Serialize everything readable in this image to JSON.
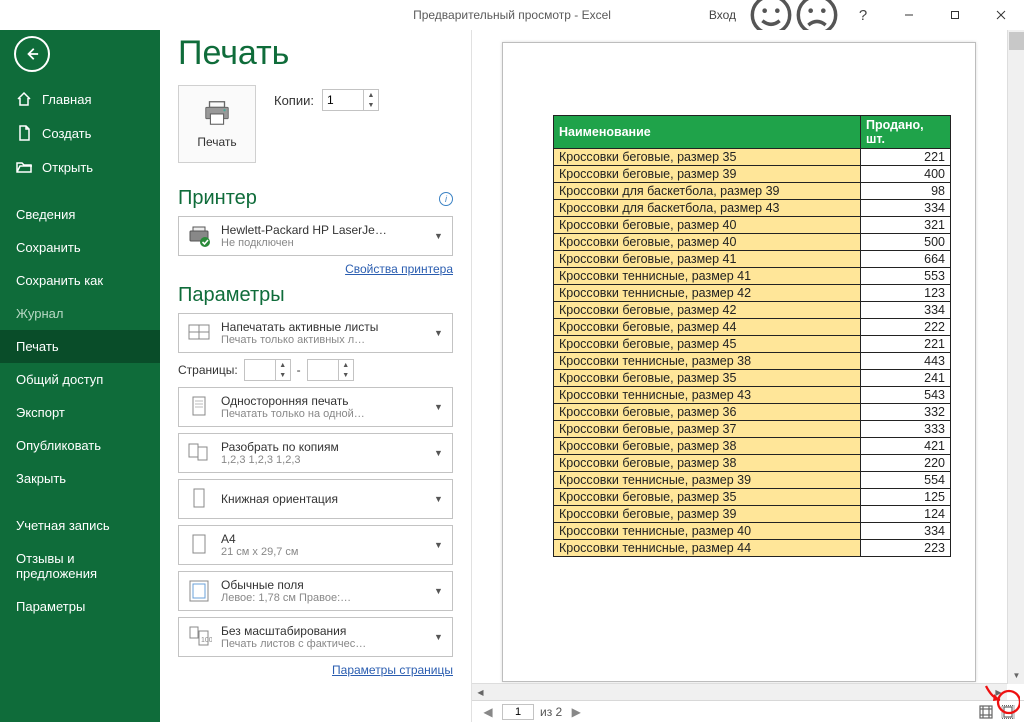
{
  "titlebar": {
    "title": "Предварительный просмотр  -  Excel",
    "login": "Вход"
  },
  "sidebar": {
    "items": [
      {
        "label": "Главная"
      },
      {
        "label": "Создать"
      },
      {
        "label": "Открыть"
      },
      {
        "label": "Сведения"
      },
      {
        "label": "Сохранить"
      },
      {
        "label": "Сохранить как"
      },
      {
        "label": "Журнал"
      },
      {
        "label": "Печать"
      },
      {
        "label": "Общий доступ"
      },
      {
        "label": "Экспорт"
      },
      {
        "label": "Опубликовать"
      },
      {
        "label": "Закрыть"
      },
      {
        "label": "Учетная запись"
      },
      {
        "label": "Отзывы и предложения"
      },
      {
        "label": "Параметры"
      }
    ]
  },
  "page_title": "Печать",
  "print": {
    "button": "Печать",
    "copies_label": "Копии:",
    "copies_value": "1"
  },
  "printer": {
    "section": "Принтер",
    "name": "Hewlett-Packard HP LaserJe…",
    "status": "Не подключен",
    "props_link": "Свойства принтера"
  },
  "params": {
    "section": "Параметры",
    "active_sheets": {
      "l1": "Напечатать активные листы",
      "l2": "Печать только активных л…"
    },
    "pages_label": "Страницы:",
    "pages_sep": "-",
    "duplex": {
      "l1": "Односторонняя печать",
      "l2": "Печатать только на одной…"
    },
    "collate": {
      "l1": "Разобрать по копиям",
      "l2": "1,2,3   1,2,3   1,2,3"
    },
    "orient": {
      "l1": "Книжная ориентация"
    },
    "paper": {
      "l1": "A4",
      "l2": "21 см x 29,7 см"
    },
    "margins": {
      "l1": "Обычные поля",
      "l2": "Левое:  1,78 см   Правое:…"
    },
    "scaling": {
      "l1": "Без масштабирования",
      "l2": "Печать листов с фактичес…"
    },
    "page_setup_link": "Параметры страницы"
  },
  "preview": {
    "current_page": "1",
    "total_label": "из 2",
    "table_header": [
      "Наименование",
      "Продано, шт."
    ],
    "rows": [
      [
        "Кроссовки беговые, размер 35",
        "221"
      ],
      [
        "Кроссовки беговые, размер 39",
        "400"
      ],
      [
        "Кроссовки для баскетбола, размер 39",
        "98"
      ],
      [
        "Кроссовки для баскетбола, размер 43",
        "334"
      ],
      [
        "Кроссовки беговые, размер 40",
        "321"
      ],
      [
        "Кроссовки беговые, размер 40",
        "500"
      ],
      [
        "Кроссовки беговые, размер 41",
        "664"
      ],
      [
        "Кроссовки теннисные, размер 41",
        "553"
      ],
      [
        "Кроссовки теннисные, размер 42",
        "123"
      ],
      [
        "Кроссовки беговые, размер 42",
        "334"
      ],
      [
        "Кроссовки беговые, размер 44",
        "222"
      ],
      [
        "Кроссовки беговые, размер 45",
        "221"
      ],
      [
        "Кроссовки теннисные, размер 38",
        "443"
      ],
      [
        "Кроссовки беговые, размер 35",
        "241"
      ],
      [
        "Кроссовки теннисные, размер 43",
        "543"
      ],
      [
        "Кроссовки беговые, размер 36",
        "332"
      ],
      [
        "Кроссовки беговые, размер 37",
        "333"
      ],
      [
        "Кроссовки беговые, размер 38",
        "421"
      ],
      [
        "Кроссовки беговые, размер 38",
        "220"
      ],
      [
        "Кроссовки теннисные, размер 39",
        "554"
      ],
      [
        "Кроссовки беговые, размер 35",
        "125"
      ],
      [
        "Кроссовки беговые, размер 39",
        "124"
      ],
      [
        "Кроссовки теннисные, размер 40",
        "334"
      ],
      [
        "Кроссовки теннисные, размер 44",
        "223"
      ]
    ]
  }
}
